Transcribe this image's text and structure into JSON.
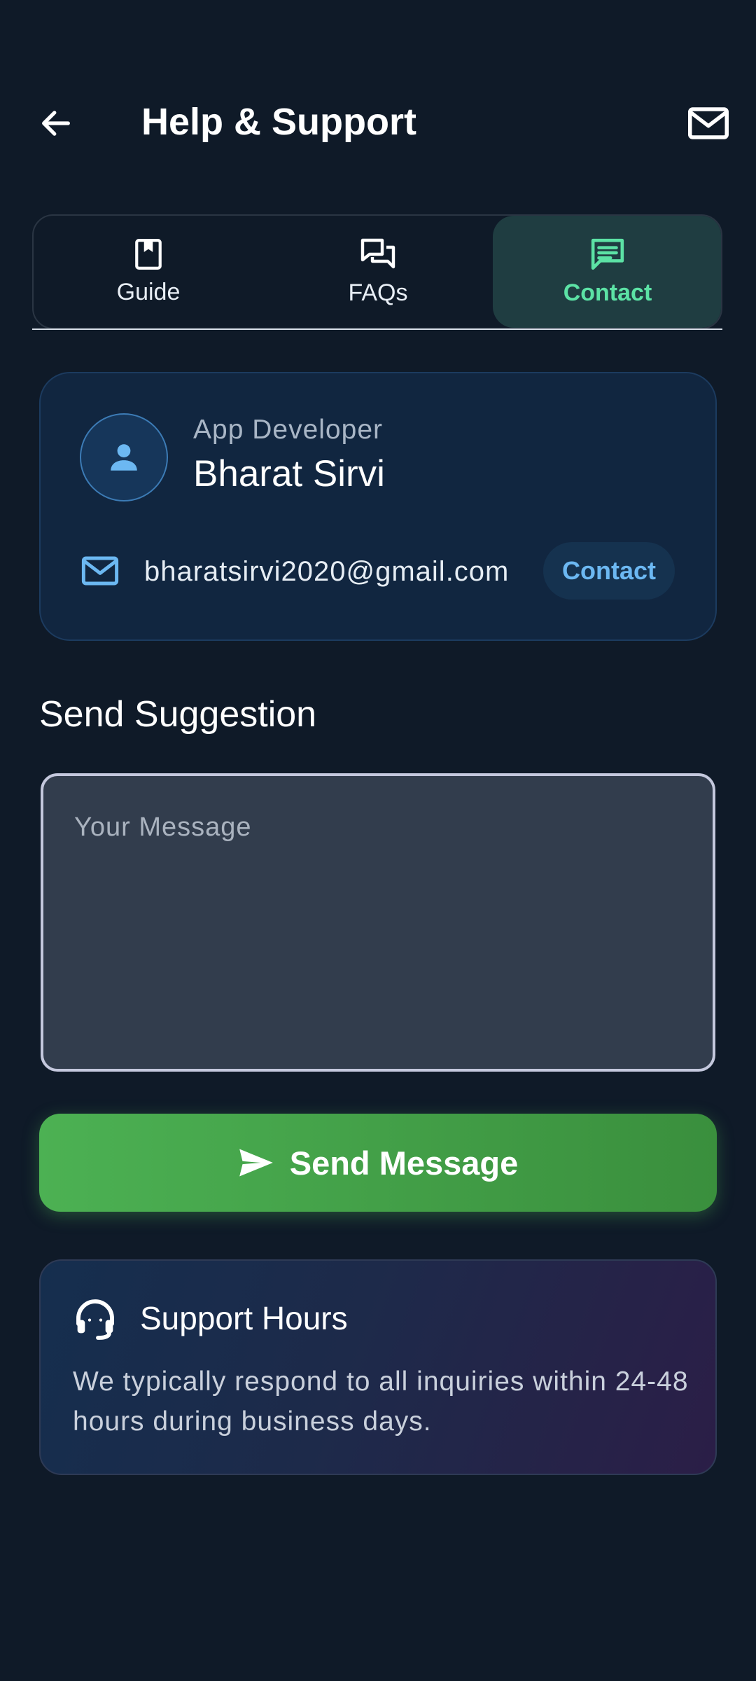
{
  "header": {
    "title": "Help & Support"
  },
  "tabs": [
    {
      "label": "Guide",
      "icon": "book-icon",
      "active": false
    },
    {
      "label": "FAQs",
      "icon": "chat-bubbles-icon",
      "active": false
    },
    {
      "label": "Contact",
      "icon": "message-icon",
      "active": true
    }
  ],
  "developer": {
    "role": "App Developer",
    "name": "Bharat Sirvi",
    "email": "bharatsirvi2020@gmail.com",
    "contact_label": "Contact"
  },
  "suggestion": {
    "title": "Send Suggestion",
    "placeholder": "Your Message",
    "send_label": "Send Message"
  },
  "support_hours": {
    "title": "Support Hours",
    "text": "We typically respond to all inquiries within 24-48 hours during business days."
  },
  "colors": {
    "background": "#0f1a28",
    "accent_green": "#4cb153",
    "active_tab_text": "#5ce2a5",
    "link_blue": "#6cb8f2"
  }
}
